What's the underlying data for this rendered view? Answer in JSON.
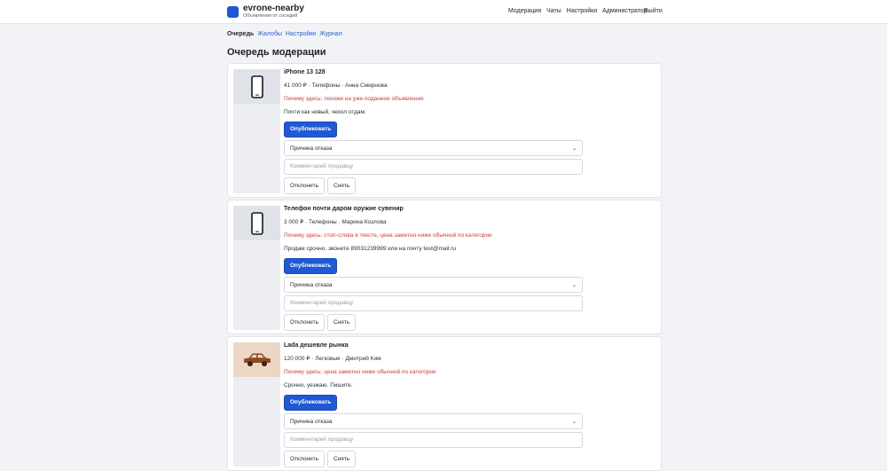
{
  "brand": {
    "name": "evrone-nearby",
    "subtitle": "Объявления от соседей"
  },
  "topnav": {
    "left": [
      "Модерация",
      "Чаты",
      "Настройки",
      "Администратор"
    ],
    "right": [
      "Выйти"
    ]
  },
  "subnav": {
    "items": [
      "Очередь",
      "Жалобы",
      "Настройки",
      "Журнал"
    ],
    "active": "Очередь"
  },
  "page": {
    "title": "Очередь модерации"
  },
  "form": {
    "publish_label": "Опубликовать",
    "select_placeholder": "Причина отказа",
    "comment_placeholder": "Комментарий продавцу",
    "reject_label": "Отклонить",
    "remove_label": "Снять"
  },
  "cards": [
    {
      "title": "iPhone 13 128",
      "meta": "41 000 ₽ · Телефоны · Анна Смирнова",
      "reason": "Почему здесь: похоже на уже поданное объявление",
      "description": "Почти как новый, чехол отдам.",
      "icon": "smartphone-icon"
    },
    {
      "title": "Телефон почти даром оружие сувенир",
      "meta": "3 000 ₽ · Телефоны · Марина Козлова",
      "reason": "Почему здесь: стоп-слова в тексте, цена заметно ниже обычной по категории",
      "description": "Продам срочно, звоните 89031239999 или на почту test@mail.ru",
      "icon": "smartphone-icon"
    },
    {
      "title": "Lada дешевле рынка",
      "meta": "120 000 ₽ · Легковые · Дмитрий Ким",
      "reason": "Почему здесь: цена заметно ниже обычной по категории",
      "description": "Срочно, уезжаю. Пишите.",
      "icon": "car-icon"
    }
  ],
  "colors": {
    "accent": "#2059d6",
    "reason": "#e4383b",
    "background": "#f2f3f6"
  }
}
